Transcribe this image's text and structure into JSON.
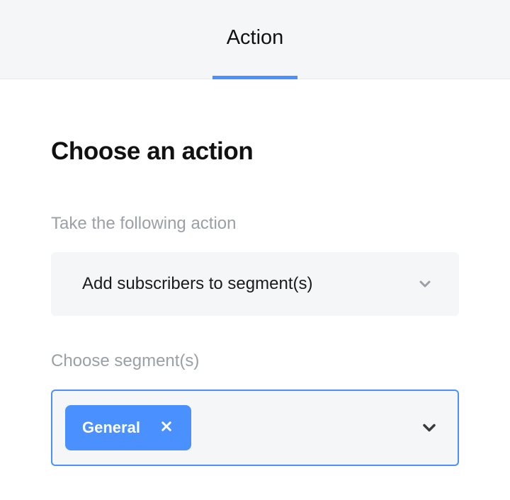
{
  "colors": {
    "accent": "#4a90ff",
    "soft_bg": "#f5f6f7",
    "muted_text": "#9aa0a6"
  },
  "tab": {
    "label": "Action"
  },
  "panel": {
    "title": "Choose an action",
    "action_label": "Take the following action",
    "action_value": "Add subscribers to segment(s)",
    "segments_label": "Choose segment(s)",
    "segments": [
      {
        "label": "General"
      }
    ]
  }
}
